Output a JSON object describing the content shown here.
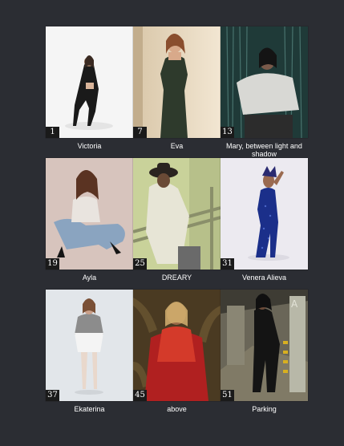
{
  "gallery": {
    "items": [
      {
        "page": "1",
        "title": "Victoria"
      },
      {
        "page": "7",
        "title": "Eva"
      },
      {
        "page": "13",
        "title": "Mary, between light and shadow"
      },
      {
        "page": "19",
        "title": "Ayla"
      },
      {
        "page": "25",
        "title": "DREARY"
      },
      {
        "page": "31",
        "title": "Venera Alieva"
      },
      {
        "page": "37",
        "title": "Ekaterina"
      },
      {
        "page": "45",
        "title": "above"
      },
      {
        "page": "51",
        "title": "Parking"
      }
    ]
  }
}
